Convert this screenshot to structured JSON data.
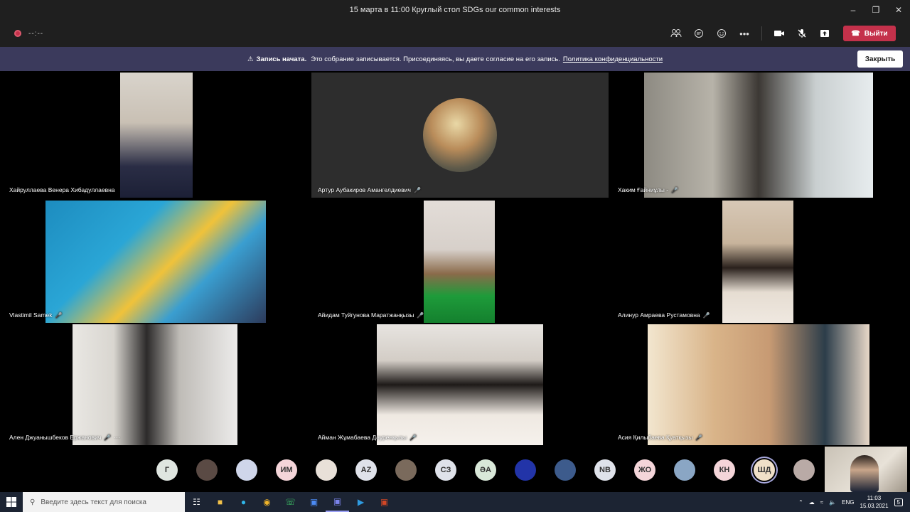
{
  "window": {
    "title": "15 марта в 11:00 Круглый стол SDGs our common interests"
  },
  "toolbar": {
    "timer": "--:--",
    "leave_label": "Выйти"
  },
  "banner": {
    "heading": "Запись начата.",
    "text": "Это собрание записывается. Присоединяясь, вы даете согласие на его запись.",
    "link": "Политика конфиденциальности",
    "close_label": "Закрыть"
  },
  "participants": [
    {
      "name": "Хайруллаева Венера Хибадуллаевна",
      "muted": false
    },
    {
      "name": "Артур Аубакиров Амангелдиевич",
      "muted": true
    },
    {
      "name": "Хаким Ғайниұлы -",
      "muted": true
    },
    {
      "name": "Vlastimil Samek",
      "muted": true
    },
    {
      "name": "Айидам Туйгунова Маратжанқызы",
      "muted": true
    },
    {
      "name": "Алинур Амраева Рустамовна",
      "muted": true
    },
    {
      "name": "Ален Джуанышбеков Ержанович",
      "muted": true
    },
    {
      "name": "Айман Жұмабаева Дәуренқызы",
      "muted": true
    },
    {
      "name": "Асия Қилыбаева Қуатқызы",
      "muted": true
    }
  ],
  "more_options": "···",
  "roster": [
    {
      "initials": "Г",
      "color": "#dfe5e0"
    },
    {
      "initials": "",
      "color": "#5a4a44"
    },
    {
      "initials": "",
      "color": "#cfd6ea"
    },
    {
      "initials": "ИМ",
      "color": "#f4d5d9"
    },
    {
      "initials": "",
      "color": "#e8e0d8"
    },
    {
      "initials": "AZ",
      "color": "#dfe2ea"
    },
    {
      "initials": "",
      "color": "#7a6a5c"
    },
    {
      "initials": "СЗ",
      "color": "#dfe2ea"
    },
    {
      "initials": "ӘА",
      "color": "#d9e8d9"
    },
    {
      "initials": "",
      "color": "#2234a8"
    },
    {
      "initials": "",
      "color": "#3d5b8c"
    },
    {
      "initials": "NB",
      "color": "#dfe2ea"
    },
    {
      "initials": "ЖО",
      "color": "#f4d5d9"
    },
    {
      "initials": "",
      "color": "#8aa6c4"
    },
    {
      "initials": "КН",
      "color": "#f4d5d9"
    },
    {
      "initials": "ШД",
      "color": "#f0e0c8"
    },
    {
      "initials": "",
      "color": "#b9aaa6"
    }
  ],
  "taskbar": {
    "search_placeholder": "Введите здесь текст для поиска",
    "lang": "ENG",
    "time": "11:03",
    "date": "15.03.2021",
    "notifications": "5"
  }
}
